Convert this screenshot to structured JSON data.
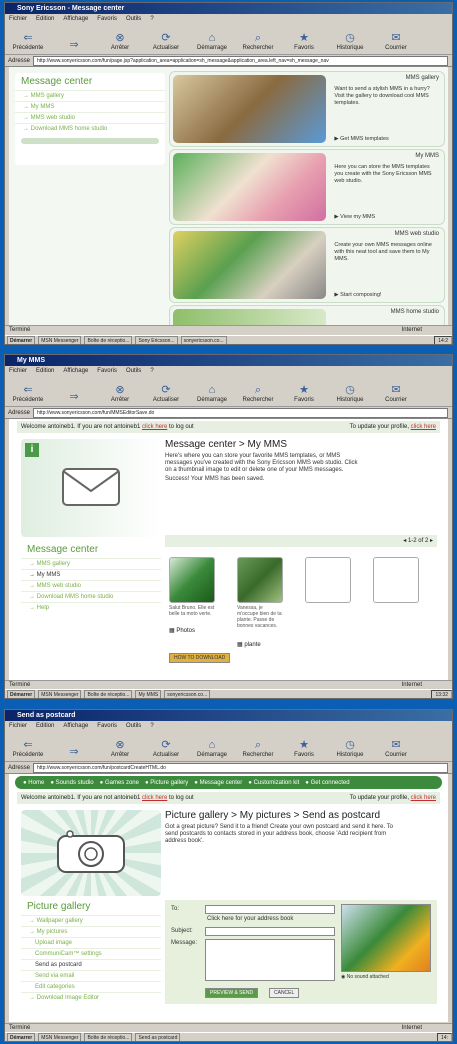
{
  "screens": [
    {
      "window_title": "Sony Ericsson - Message center",
      "menu": [
        "Fichier",
        "Edition",
        "Affichage",
        "Favoris",
        "Outils",
        "?"
      ],
      "toolbar": [
        "Précédente",
        "→",
        "Arrêter",
        "Actualiser",
        "Démarrage",
        "Rechercher",
        "Favoris",
        "Historique",
        "Courrier"
      ],
      "address_label": "Adresse",
      "address": "http://www.sonyericsson.com/fun/page.jsp?application_area=application=sh_message&application_area.left_nav=sh_message_nav",
      "sidebar_title": "Message center",
      "sidebar_items": [
        "→ MMS gallery",
        "→ My MMS",
        "→ MMS web studio",
        "→ Download MMS home studio"
      ],
      "cards": [
        {
          "title": "MMS gallery",
          "desc": "Want to send a stylish MMS in a hurry? Visit the gallery to download cool MMS templates.",
          "action": "Get MMS templates"
        },
        {
          "title": "My MMS",
          "desc": "Here you can store the MMS templates you create with the Sony Ericsson MMS web studio.",
          "action": "View my MMS"
        },
        {
          "title": "MMS web studio",
          "desc": "Create your own MMS messages online with this neat tool and save them to My MMS.",
          "action": "Start composing!"
        },
        {
          "title": "MMS home studio",
          "desc": "",
          "action": ""
        }
      ],
      "status": "Terminé",
      "zone": "Internet",
      "taskbar": [
        "Démarrer",
        "MSN Messenger",
        "Boîte de réceptio...",
        "Sony Ericsson...",
        "sonyericsson.co..."
      ],
      "clock": "14:2"
    },
    {
      "window_title": "My MMS",
      "menu": [
        "Fichier",
        "Edition",
        "Affichage",
        "Favoris",
        "Outils",
        "?"
      ],
      "toolbar": [
        "Précédente",
        "→",
        "Arrêter",
        "Actualiser",
        "Démarrage",
        "Rechercher",
        "Favoris",
        "Historique",
        "Courrier"
      ],
      "address_label": "Adresse",
      "address": "http://www.sonyericsson.com/fun/MMSEditorSave.do",
      "welcome": "Welcome antoineb1. If you are not antoineb1",
      "welcome_link": "click here",
      "welcome_tail": "to log out",
      "profile_text": "To update your profile,",
      "profile_link": "click here",
      "heading": "Message center > My MMS",
      "body": "Here's where you can store your favorite MMS templates, or MMS messages you've created with the Sony Ericsson MMS web studio. Click on a thumbnail image to edit or delete one of your MMS messages.",
      "success": "Success! Your MMS has been saved.",
      "sidebar_title": "Message center",
      "sidebar_items": [
        "→ MMS gallery",
        "→ My MMS",
        "→ MMS web studio",
        "→ Download MMS home studio",
        "→ Help"
      ],
      "pager": "1-2 of 2",
      "thumbs": [
        {
          "caption": "Salut Bruno. Elle est belle ta moto verte.",
          "label": "Photos"
        },
        {
          "caption": "Vanessa, je m'occupe bien de ta plante. Passe de bonnes vacances.",
          "label": "plante"
        }
      ],
      "howto": "HOW TO DOWNLOAD",
      "status": "Terminé",
      "zone": "Internet",
      "taskbar": [
        "Démarrer",
        "MSN Messenger",
        "Boîte de réceptio...",
        "My MMS",
        "sonyericsson.co..."
      ],
      "clock": "13:32"
    },
    {
      "window_title": "Send as postcard",
      "menu": [
        "Fichier",
        "Edition",
        "Affichage",
        "Favoris",
        "Outils",
        "?"
      ],
      "toolbar": [
        "Précédente",
        "→",
        "Arrêter",
        "Actualiser",
        "Démarrage",
        "Rechercher",
        "Favoris",
        "Historique",
        "Courrier"
      ],
      "address_label": "Adresse",
      "address": "http://www.sonyericsson.com/fun/postcardCreateHTML.do",
      "topnav": [
        "Home",
        "Sounds studio",
        "Games zone",
        "Picture gallery",
        "Message center",
        "Customization kit",
        "Get connected"
      ],
      "welcome": "Welcome antoineb1. If you are not antoineb1",
      "welcome_link": "click here",
      "welcome_tail": "to log out",
      "profile_text": "To update your profile,",
      "profile_link": "click here",
      "heading": "Picture gallery > My pictures > Send as postcard",
      "body": "Got a great picture? Send it to a friend! Create your own postcard and send it here. To send postcards to contacts stored in your address book, choose 'Add recipient from address book'.",
      "sidebar_title": "Picture gallery",
      "sidebar_items": [
        "→ Wallpaper gallery",
        "→ My pictures",
        "Upload image",
        "CommuniCam™ settings",
        "Send as postcard",
        "Send via email",
        "Edit categories",
        "→ Download Image Editor"
      ],
      "to_label": "To:",
      "address_book": "Click here for your address book",
      "subject_label": "Subject:",
      "message_label": "Message:",
      "preview_btn": "PREVIEW & SEND",
      "cancel_btn": "CANCEL",
      "sound_attached": "No sound attached",
      "status": "Terminé",
      "zone": "Internet",
      "taskbar": [
        "Démarrer",
        "MSN Messenger",
        "Boîte de réceptio...",
        "Send as postcard"
      ],
      "clock": "14:"
    }
  ]
}
